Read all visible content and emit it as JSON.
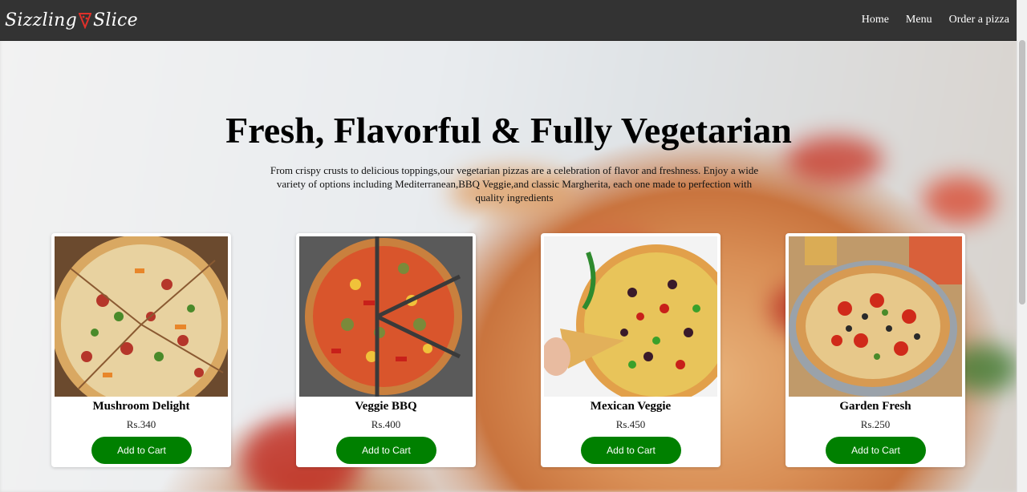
{
  "brand": {
    "name_part1": "Sizzling",
    "name_part2": "Slice"
  },
  "nav": {
    "items": [
      {
        "label": "Home"
      },
      {
        "label": "Menu"
      },
      {
        "label": "Order a pizza"
      }
    ]
  },
  "hero": {
    "title": "Fresh, Flavorful & Fully Vegetarian",
    "description": "From crispy crusts to delicious toppings,our vegetarian pizzas are a celebration of flavor and freshness. Enjoy a wide variety of options including Mediterranean,BBQ Veggie,and classic Margherita, each one made to perfection with quality ingredients"
  },
  "products": [
    {
      "name": "Mushroom Delight",
      "price": "Rs.340",
      "button": "Add to Cart"
    },
    {
      "name": "Veggie BBQ",
      "price": "Rs.400",
      "button": "Add to Cart"
    },
    {
      "name": "Mexican Veggie",
      "price": "Rs.450",
      "button": "Add to Cart"
    },
    {
      "name": "Garden Fresh",
      "price": "Rs.250",
      "button": "Add to Cart"
    }
  ],
  "colors": {
    "navbar": "#333333",
    "button": "#008000",
    "brand_accent": "#e0302a"
  },
  "icons": {
    "logo": "pizza-slice-icon"
  }
}
